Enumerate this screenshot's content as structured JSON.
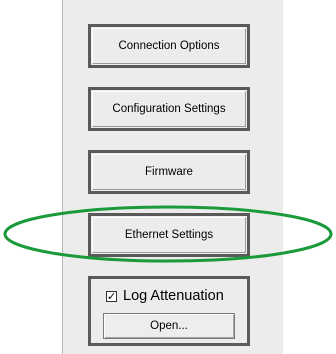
{
  "panel": {
    "buttons": [
      {
        "label": "Connection Options"
      },
      {
        "label": "Configuration Settings"
      },
      {
        "label": "Firmware"
      },
      {
        "label": "Ethernet Settings"
      }
    ],
    "log_group": {
      "checkbox_label": "Log Attenuation",
      "checkbox_checked": true,
      "checkbox_mark": "✓",
      "open_label": "Open..."
    }
  },
  "annotation": {
    "highlight_color": "#1a9a3a",
    "highlighted_item": "Ethernet Settings"
  }
}
